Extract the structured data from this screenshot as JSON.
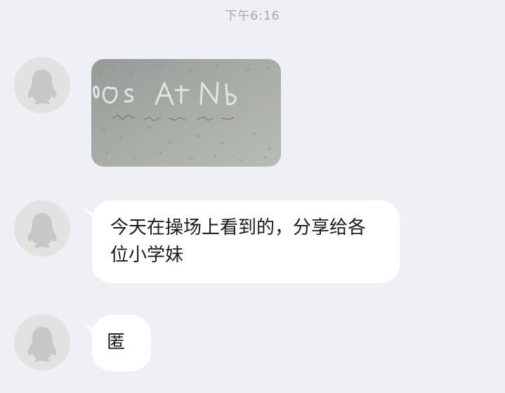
{
  "chat": {
    "timestamp": "下午6:16",
    "messages": [
      {
        "type": "image",
        "image_text": "Os At Nb"
      },
      {
        "type": "text",
        "text": "今天在操场上看到的，分享给各位小学妹"
      },
      {
        "type": "text",
        "text": "匿"
      }
    ]
  },
  "colors": {
    "background": "#eef0f5",
    "bubble": "#ffffff",
    "avatar_bg": "#e4e2e0",
    "avatar_icon": "#c9c7c5",
    "timestamp_text": "#a3a6ad"
  },
  "icons": {
    "avatar": "penguin-icon"
  }
}
